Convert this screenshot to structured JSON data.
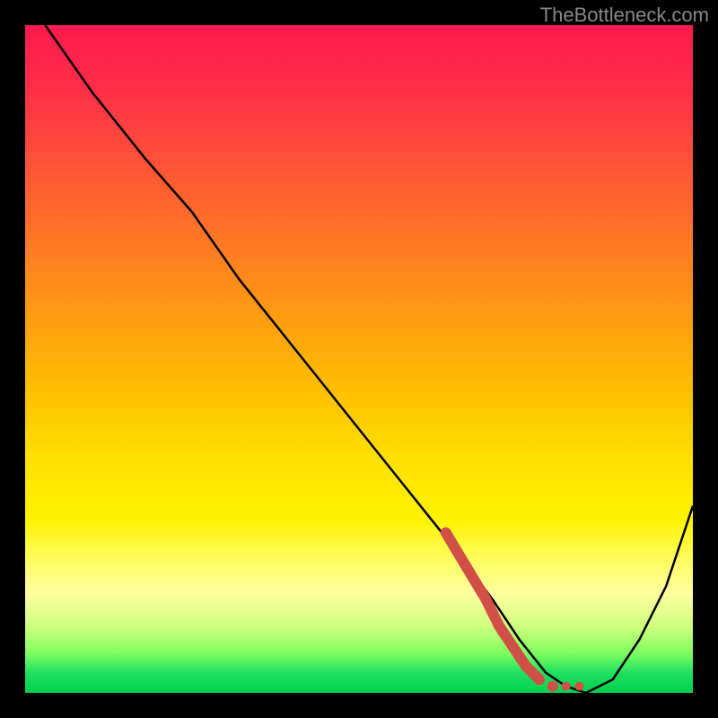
{
  "watermark": "TheBottleneck.com",
  "chart_data": {
    "type": "line",
    "title": "",
    "xlabel": "",
    "ylabel": "",
    "xlim": [
      0,
      100
    ],
    "ylim": [
      0,
      100
    ],
    "series": [
      {
        "name": "bottleneck-curve",
        "color": "#000000",
        "x": [
          3,
          10,
          18,
          25,
          32,
          40,
          48,
          56,
          64,
          70,
          74,
          78,
          81,
          84,
          88,
          92,
          96,
          100
        ],
        "y": [
          100,
          90,
          80,
          72,
          62,
          52,
          42,
          32,
          22,
          14,
          8,
          3,
          1,
          0,
          2,
          8,
          16,
          28
        ]
      },
      {
        "name": "highlighted-region",
        "color": "#d05048",
        "style": "thick-dotted",
        "x": [
          63,
          66,
          69,
          71,
          73,
          75,
          77,
          79,
          81,
          83
        ],
        "y": [
          24,
          19,
          14,
          10,
          7,
          4,
          2,
          1,
          1,
          1
        ]
      }
    ]
  }
}
